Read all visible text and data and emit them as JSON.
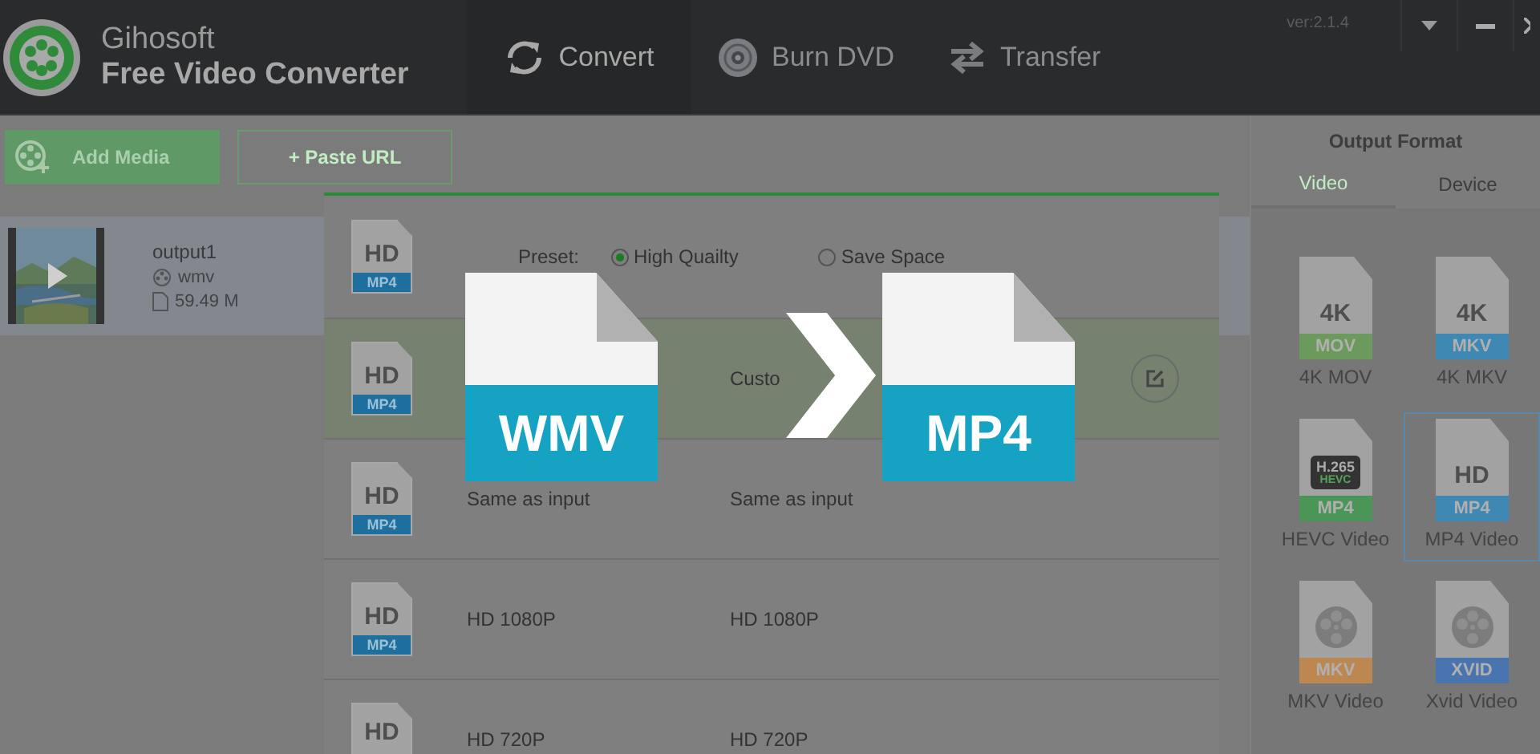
{
  "app": {
    "brand": "Gihosoft",
    "title": "Free Video Converter",
    "version": "ver:2.1.4"
  },
  "nav_tabs": [
    {
      "label": "Convert",
      "kind": "convert",
      "selected": true
    },
    {
      "label": "Burn DVD",
      "kind": "disc",
      "selected": false
    },
    {
      "label": "Transfer",
      "kind": "transfer",
      "selected": false
    }
  ],
  "toolbar": {
    "add_media": "Add Media",
    "paste_url": "+ Paste URL"
  },
  "file": {
    "name": "output1",
    "format": "wmv",
    "size": "59.49 M"
  },
  "preset_panel": {
    "icon_top": "HD",
    "icon_tag": "MP4",
    "label": "Preset:",
    "options": [
      {
        "label": "High Quailty",
        "selected": true
      },
      {
        "label": "Save Space",
        "selected": false
      }
    ],
    "rows": [
      {
        "quality": "Custo",
        "selected": true,
        "icon_top": "HD",
        "icon_tag": "MP4"
      },
      {
        "name": "Same as input",
        "quality": "Same as input",
        "selected": false,
        "icon_top": "HD",
        "icon_tag": "MP4"
      },
      {
        "name": "HD 1080P",
        "quality": "HD 1080P",
        "selected": false,
        "icon_top": "HD",
        "icon_tag": "MP4"
      },
      {
        "name": "HD 720P",
        "quality": "HD 720P",
        "selected": false,
        "icon_top": "HD"
      }
    ]
  },
  "output_format": {
    "title": "Output Format",
    "tabs": [
      {
        "label": "Video",
        "selected": true
      },
      {
        "label": "Device",
        "selected": false
      }
    ],
    "formats": [
      {
        "kind": "text",
        "top": "4K",
        "tag": "MOV",
        "color": "#6b9a5c",
        "name": "4K MOV",
        "selected": false
      },
      {
        "kind": "text",
        "top": "4K",
        "tag": "MKV",
        "color": "#3f88b4",
        "name": "4K MKV",
        "selected": false
      },
      {
        "kind": "hevc",
        "top": "H.265",
        "sub": "HEVC",
        "tag": "MP4",
        "color": "#4a9557",
        "name": "HEVC Video",
        "selected": false
      },
      {
        "kind": "text",
        "top": "HD",
        "tag": "MP4",
        "color": "#3f88b4",
        "name": "MP4 Video",
        "selected": true
      },
      {
        "kind": "reel",
        "tag": "MKV",
        "color": "#bd8752",
        "name": "MKV Video",
        "selected": false
      },
      {
        "kind": "reel",
        "tag": "XVID",
        "color": "#4a74b0",
        "name": "Xvid Video",
        "selected": false
      }
    ]
  },
  "overlay": {
    "from": "WMV",
    "to": "MP4"
  }
}
